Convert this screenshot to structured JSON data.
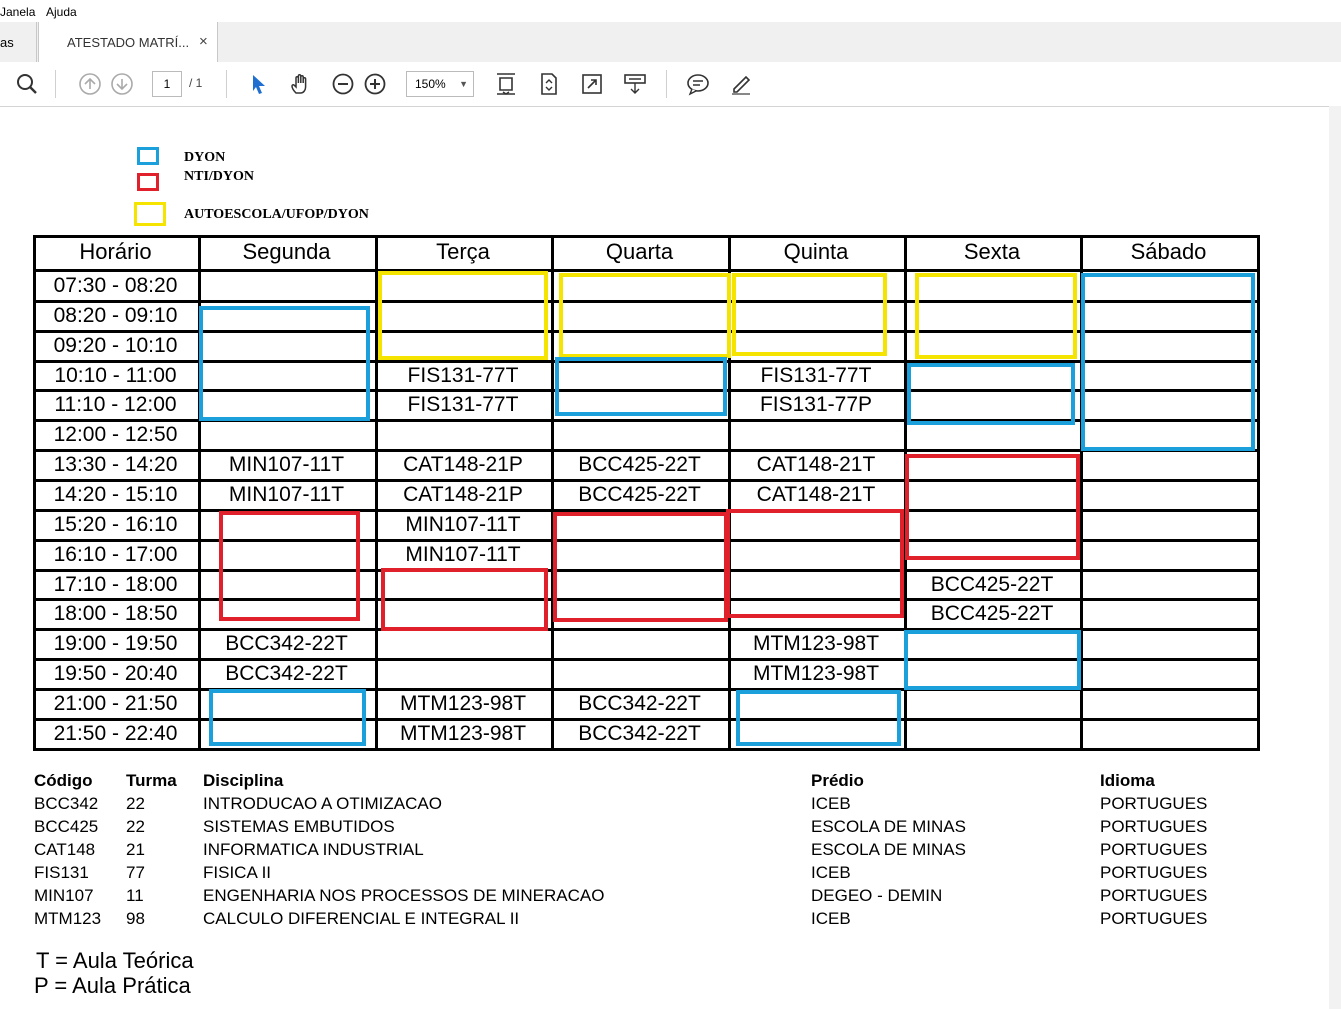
{
  "menu": [
    "Janela",
    "Ajuda"
  ],
  "tabs": {
    "previous_fragment": "as",
    "active": "ATESTADO MATRÍ...",
    "close_glyph": "×"
  },
  "toolbar": {
    "page_current": "1",
    "page_total": "/ 1",
    "zoom": "150%",
    "icons": [
      "search-icon",
      "previous-page-icon",
      "next-page-icon",
      "select-cursor-icon",
      "hand-tool-icon",
      "zoom-out-icon",
      "zoom-in-icon",
      "scroll-mode-icon",
      "page-fit-icon",
      "full-screen-icon",
      "read-mode-icon",
      "comment-icon",
      "highlight-pen-icon"
    ]
  },
  "legend": [
    {
      "label": "DYON",
      "color": "#1ca0dc"
    },
    {
      "label": "NTI/DYON",
      "color": "#e0202a"
    },
    {
      "label": "AUTOESCOLA/UFOP/DYON",
      "color": "#f5e400"
    }
  ],
  "schedule": {
    "columns": [
      "Horário",
      "Segunda",
      "Terça",
      "Quarta",
      "Quinta",
      "Sexta",
      "Sábado"
    ],
    "rows": [
      {
        "time": "07:30 - 08:20",
        "cells": [
          "",
          "",
          "",
          "",
          "",
          ""
        ]
      },
      {
        "time": "08:20 - 09:10",
        "cells": [
          "",
          "",
          "",
          "",
          "",
          ""
        ]
      },
      {
        "time": "09:20 - 10:10",
        "cells": [
          "",
          "",
          "",
          "",
          "",
          ""
        ]
      },
      {
        "time": "10:10 - 11:00",
        "cells": [
          "",
          "FIS131-77T",
          "",
          "FIS131-77T",
          "",
          ""
        ]
      },
      {
        "time": "11:10 - 12:00",
        "cells": [
          "",
          "FIS131-77T",
          "",
          "FIS131-77P",
          "",
          ""
        ]
      },
      {
        "time": "12:00 - 12:50",
        "cells": [
          "",
          "",
          "",
          "",
          "",
          ""
        ]
      },
      {
        "time": "13:30 - 14:20",
        "cells": [
          "MIN107-11T",
          "CAT148-21P",
          "BCC425-22T",
          "CAT148-21T",
          "",
          ""
        ]
      },
      {
        "time": "14:20 - 15:10",
        "cells": [
          "MIN107-11T",
          "CAT148-21P",
          "BCC425-22T",
          "CAT148-21T",
          "",
          ""
        ]
      },
      {
        "time": "15:20 - 16:10",
        "cells": [
          "",
          "MIN107-11T",
          "",
          "",
          "",
          ""
        ]
      },
      {
        "time": "16:10 - 17:00",
        "cells": [
          "",
          "MIN107-11T",
          "",
          "",
          "",
          ""
        ]
      },
      {
        "time": "17:10 - 18:00",
        "cells": [
          "",
          "",
          "",
          "",
          "BCC425-22T",
          ""
        ]
      },
      {
        "time": "18:00 - 18:50",
        "cells": [
          "",
          "",
          "",
          "",
          "BCC425-22T",
          ""
        ]
      },
      {
        "time": "19:00 - 19:50",
        "cells": [
          "BCC342-22T",
          "",
          "",
          "MTM123-98T",
          "",
          ""
        ]
      },
      {
        "time": "19:50 - 20:40",
        "cells": [
          "BCC342-22T",
          "",
          "",
          "MTM123-98T",
          "",
          ""
        ]
      },
      {
        "time": "21:00 - 21:50",
        "cells": [
          "",
          "MTM123-98T",
          "BCC342-22T",
          "",
          "",
          ""
        ]
      },
      {
        "time": "21:50 - 22:40",
        "cells": [
          "",
          "MTM123-98T",
          "BCC342-22T",
          "",
          "",
          ""
        ]
      }
    ]
  },
  "highlights": [
    {
      "color": "yellow",
      "day": "Terça",
      "rows": "07:30 - 09:20"
    },
    {
      "color": "yellow",
      "day": "Quarta",
      "rows": "07:30 - 09:20"
    },
    {
      "color": "yellow",
      "day": "Quinta",
      "rows": "07:30 - 09:20"
    },
    {
      "color": "yellow",
      "day": "Sexta",
      "rows": "07:30 - 09:20"
    },
    {
      "color": "blue",
      "day": "Segunda",
      "rows": "08:20 - 12:00"
    },
    {
      "color": "blue",
      "day": "Quarta",
      "rows": "10:10 - 12:00"
    },
    {
      "color": "blue",
      "day": "Sexta",
      "rows": "10:10 - 12:00"
    },
    {
      "color": "blue",
      "day": "Sábado",
      "rows": "07:30 - 12:50"
    },
    {
      "color": "red",
      "day": "Segunda",
      "rows": "15:20 - 18:50"
    },
    {
      "color": "red",
      "day": "Terça",
      "rows": "17:10 - 18:50"
    },
    {
      "color": "red",
      "day": "Quarta",
      "rows": "15:20 - 18:50"
    },
    {
      "color": "red",
      "day": "Quinta",
      "rows": "15:20 - 18:50"
    },
    {
      "color": "red",
      "day": "Sexta",
      "rows": "13:30 - 17:00"
    },
    {
      "color": "blue",
      "day": "Sexta",
      "rows": "19:00 - 20:40"
    },
    {
      "color": "blue",
      "day": "Segunda",
      "rows": "21:00 - 22:40"
    },
    {
      "color": "blue",
      "day": "Quinta",
      "rows": "21:00 - 22:40"
    }
  ],
  "courses": {
    "headers": [
      "Código",
      "Turma",
      "Disciplina",
      "Prédio",
      "Idioma"
    ],
    "rows": [
      [
        "BCC342",
        "22",
        "INTRODUCAO A OTIMIZACAO",
        "ICEB",
        "PORTUGUES"
      ],
      [
        "BCC425",
        "22",
        "SISTEMAS EMBUTIDOS",
        "ESCOLA DE MINAS",
        "PORTUGUES"
      ],
      [
        "CAT148",
        "21",
        "INFORMATICA INDUSTRIAL",
        "ESCOLA DE MINAS",
        "PORTUGUES"
      ],
      [
        "FIS131",
        "77",
        "FISICA II",
        "ICEB",
        "PORTUGUES"
      ],
      [
        "MIN107",
        "11",
        "ENGENHARIA NOS PROCESSOS DE MINERACAO",
        "DEGEO - DEMIN",
        "PORTUGUES"
      ],
      [
        "MTM123",
        "98",
        "CALCULO DIFERENCIAL E INTEGRAL II",
        "ICEB",
        "PORTUGUES"
      ]
    ]
  },
  "footnotes": [
    "T = Aula Teórica",
    "P = Aula Prática"
  ]
}
